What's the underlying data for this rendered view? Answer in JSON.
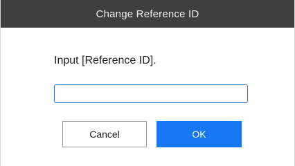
{
  "dialog": {
    "title": "Change Reference ID",
    "prompt": "Input [Reference ID].",
    "input": {
      "value": "",
      "placeholder": ""
    },
    "buttons": {
      "cancel_label": "Cancel",
      "ok_label": "OK"
    }
  },
  "colors": {
    "titlebar": "#3f3f3f",
    "accent": "#1877f2",
    "input_border": "#2f6fc6"
  }
}
